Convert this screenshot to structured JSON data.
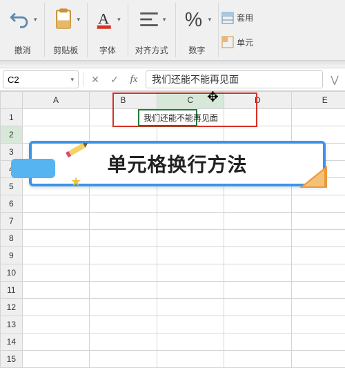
{
  "ribbon": {
    "undo": "撤消",
    "clipboard": "剪贴板",
    "font": "字体",
    "alignment": "对齐方式",
    "number": "数字",
    "side": {
      "insert": "套用",
      "cell": "单元"
    }
  },
  "namebox": "C2",
  "formula": "我们还能不能再见面",
  "columns": [
    "A",
    "B",
    "C",
    "D",
    "E"
  ],
  "rows": [
    "1",
    "2",
    "3",
    "4",
    "5",
    "6",
    "7",
    "8",
    "9",
    "10",
    "11",
    "12",
    "13",
    "14",
    "15"
  ],
  "cell_c2_text": "我们还能不能再见面",
  "banner_title": "单元格换行方法",
  "icons": {
    "undo": "undo-icon",
    "clipboard": "clipboard-icon",
    "font": "font-icon",
    "alignment": "alignment-icon",
    "number": "percent-icon",
    "expand": "chevron-down-icon",
    "formula_cancel": "close-icon",
    "formula_confirm": "check-icon",
    "fx": "fx-icon",
    "table_style": "table-style-icon",
    "cell_style": "cell-style-icon"
  }
}
